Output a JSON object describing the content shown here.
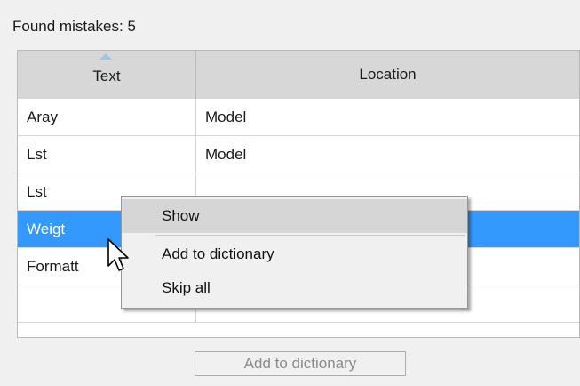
{
  "found": {
    "label": "Found mistakes: 5"
  },
  "table": {
    "columns": [
      "Text",
      "Location"
    ],
    "sort_column": "Text",
    "rows": [
      {
        "text": "Aray",
        "location": "Model"
      },
      {
        "text": "Lst",
        "location": "Model"
      },
      {
        "text": "Lst",
        "location": ""
      },
      {
        "text": "Weigt",
        "location": ""
      },
      {
        "text": "Formatt",
        "location": ""
      },
      {
        "text": "",
        "location": ""
      }
    ],
    "selected_row": 3
  },
  "footer": {
    "add_button_label": "Add to dictionary"
  },
  "context_menu": {
    "items": [
      "Show",
      "Add to dictionary",
      "Skip all"
    ],
    "hovered_index": 0
  },
  "colors": {
    "selection": "#3399ff",
    "header": "#d7d7d7"
  },
  "icons": {
    "sort": "sort-up-arrow-icon",
    "cursor": "mouse-pointer-icon"
  }
}
